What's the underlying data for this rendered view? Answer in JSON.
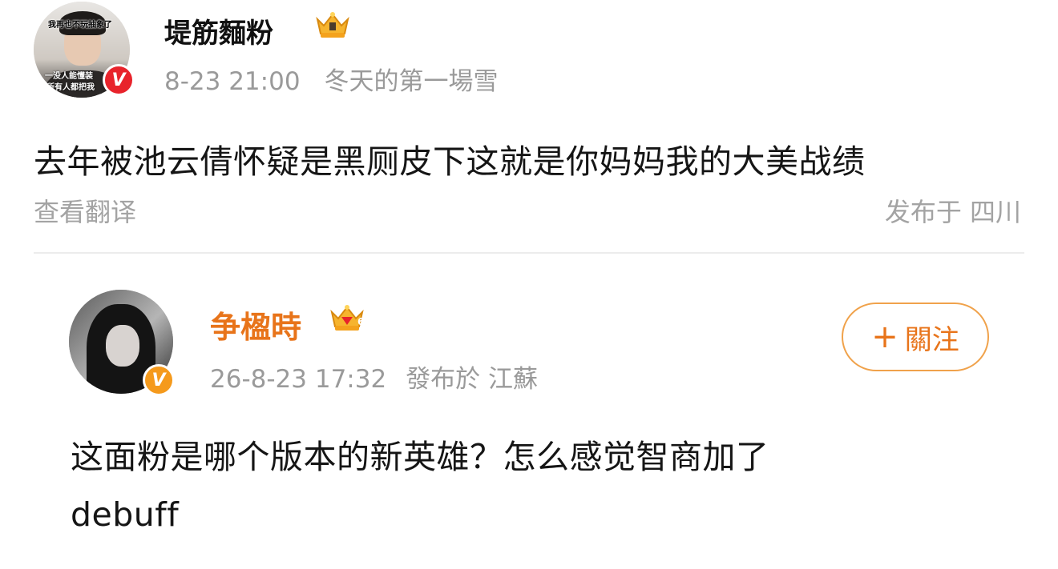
{
  "post": {
    "avatar_caption_top": "我再也不玩抽象了",
    "avatar_caption_mid": "一没人能懂装",
    "avatar_caption_bottom": "所有人都把我",
    "username": "堤筋麵粉",
    "timestamp": "8-23 21:00",
    "source": "冬天的第一場雪",
    "text": "去年被池云倩怀疑是黑厕皮下这就是你妈妈我的大美战绩",
    "translate_label": "查看翻译",
    "location": "发布于 四川",
    "verified_badge_color": "#e8232b",
    "verified_badge_letter": "V"
  },
  "reply": {
    "username": "争楹時",
    "timestamp": "26-8-23 17:32",
    "location": "發布於 江蘇",
    "follow_plus": "+",
    "follow_label": "關注",
    "text_line1": "这面粉是哪个版本的新英雄？怎么感觉智商加了",
    "text_line2": "debuff",
    "username_color": "#e8741a",
    "verified_badge_color": "#f59a1c",
    "verified_badge_letter": "V",
    "crown_level": "6"
  }
}
